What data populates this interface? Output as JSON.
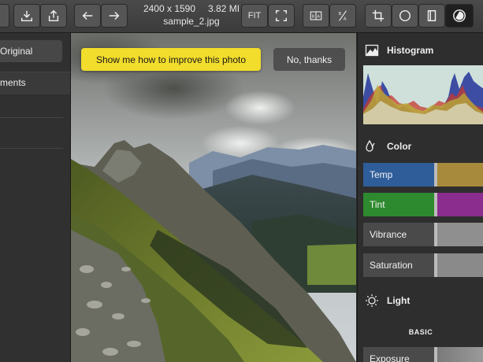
{
  "toolbar": {
    "file": {
      "dimensions": "2400 x 1590",
      "size": "3.82 MI",
      "name": "sample_2.jpg"
    },
    "fit_label": "FIT",
    "ba_label": "B|A",
    "ratio_label": "B/A"
  },
  "left_panel": {
    "original_label": "Original",
    "adjustments_label": "ments"
  },
  "canvas": {
    "improve_label": "Show me how to improve this photo",
    "nothanks_label": "No, thanks"
  },
  "right_panel": {
    "histogram_title": "Histogram",
    "color_title": "Color",
    "sliders": [
      {
        "label": "Temp",
        "color_left": "#2f5d9a",
        "color_right": "#a88a3c"
      },
      {
        "label": "Tint",
        "color_left": "#2e8a2e",
        "color_right": "#8a2d8e"
      },
      {
        "label": "Vibrance",
        "color_left": "#4a4a4a",
        "color_right": "#8f8f8f"
      },
      {
        "label": "Saturation",
        "color_left": "#4a4a4a",
        "color_right": "#8a8a8a"
      }
    ],
    "light_title": "Light",
    "basic_label": "BASIC",
    "exposure_label": "Exposure"
  },
  "colors": {
    "accent_yellow": "#f2dc2c",
    "panel_bg": "#2e2e2e"
  }
}
